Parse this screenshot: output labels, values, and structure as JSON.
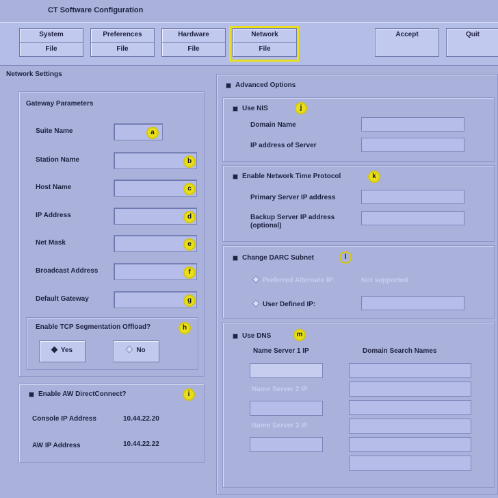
{
  "window": {
    "title": "CT Software Configuration"
  },
  "toolbar": {
    "system": {
      "top": "System",
      "bottom": "File"
    },
    "preferences": {
      "top": "Preferences",
      "bottom": "File"
    },
    "hardware": {
      "top": "Hardware",
      "bottom": "File"
    },
    "network": {
      "top": "Network",
      "bottom": "File"
    },
    "accept": "Accept",
    "quit": "Quit"
  },
  "network_settings": {
    "title": "Network Settings"
  },
  "gateway": {
    "title": "Gateway Parameters",
    "fields": [
      {
        "label": "Suite Name",
        "marker": "a"
      },
      {
        "label": "Station Name",
        "marker": "b"
      },
      {
        "label": "Host Name",
        "marker": "c"
      },
      {
        "label": "IP Address",
        "marker": "d"
      },
      {
        "label": "Net Mask",
        "marker": "e"
      },
      {
        "label": "Broadcast Address",
        "marker": "f"
      },
      {
        "label": "Default Gateway",
        "marker": "g"
      }
    ],
    "tso": {
      "label": "Enable TCP Segmentation Offload?",
      "marker": "h",
      "yes": "Yes",
      "no": "No"
    }
  },
  "aw": {
    "label": "Enable AW DirectConnect?",
    "marker": "i",
    "console_label": "Console IP Address",
    "console_value": "10.44.22.20",
    "aw_label": "AW IP Address",
    "aw_value": "10.44.22.22"
  },
  "advanced": {
    "label": "Advanced Options"
  },
  "nis": {
    "label": "Use NIS",
    "marker": "j",
    "domain_label": "Domain Name",
    "server_label": "IP address of Server"
  },
  "ntp": {
    "label": "Enable Network Time Protocol",
    "marker": "k",
    "primary_label": "Primary Server IP address",
    "backup_label": "Backup Server IP address",
    "backup_sub": "(optional)"
  },
  "darc": {
    "label": "Change DARC Subnet",
    "marker": "l",
    "preferred_label": "Preferred Alternate IP:",
    "preferred_value": "Not supported",
    "user_label": "User Defined IP:"
  },
  "dns": {
    "label": "Use DNS",
    "marker": "m",
    "ns1_label": "Name Server 1 IP",
    "search_label": "Domain Search Names",
    "ns2_label": "Name Server 2 IP",
    "ns3_label": "Name Server 3 IP"
  }
}
